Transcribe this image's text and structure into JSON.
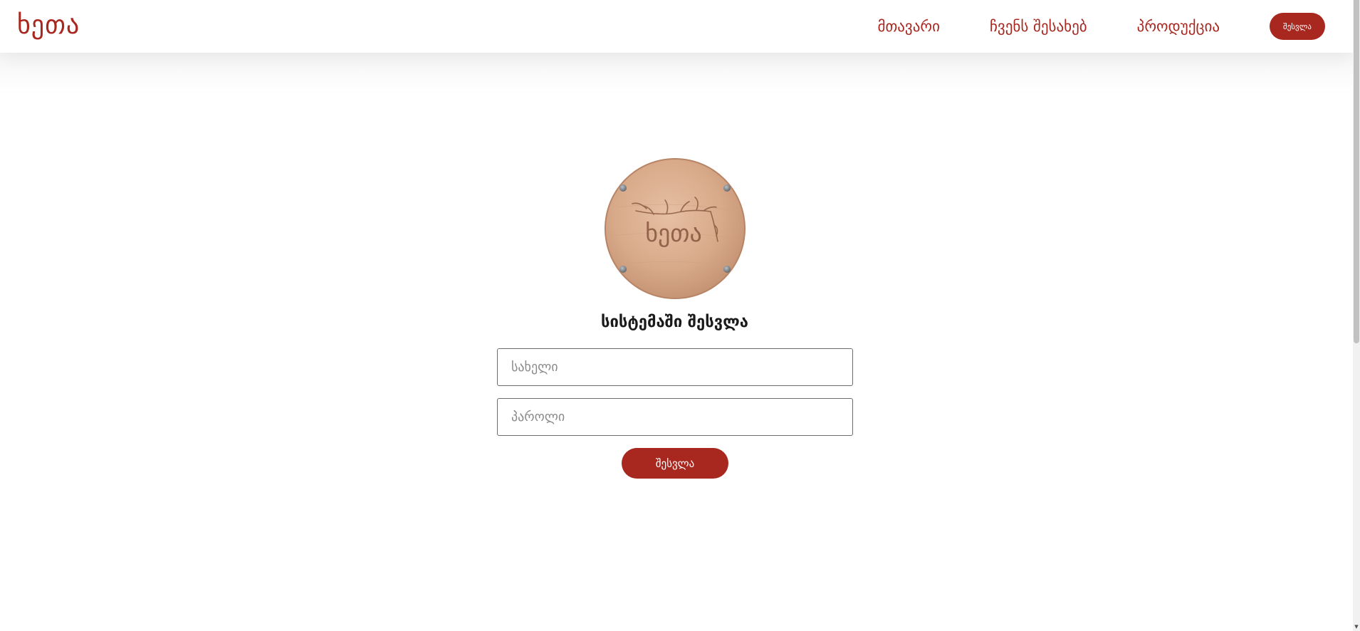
{
  "brand": {
    "logo_text": "ხეთა",
    "accent_color": "#a8271f"
  },
  "nav": {
    "items": [
      {
        "label": "მთავარი"
      },
      {
        "label": "ჩვენს შესახებ"
      },
      {
        "label": "პროდუქცია"
      }
    ],
    "login_label": "შესვლა"
  },
  "emblem": {
    "icon": "wood-tree-logo-icon",
    "text": "ხეთა"
  },
  "login": {
    "title": "სისტემაში შესვლა",
    "username_placeholder": "სახელი",
    "password_placeholder": "პაროლი",
    "submit_label": "შესვლა"
  }
}
